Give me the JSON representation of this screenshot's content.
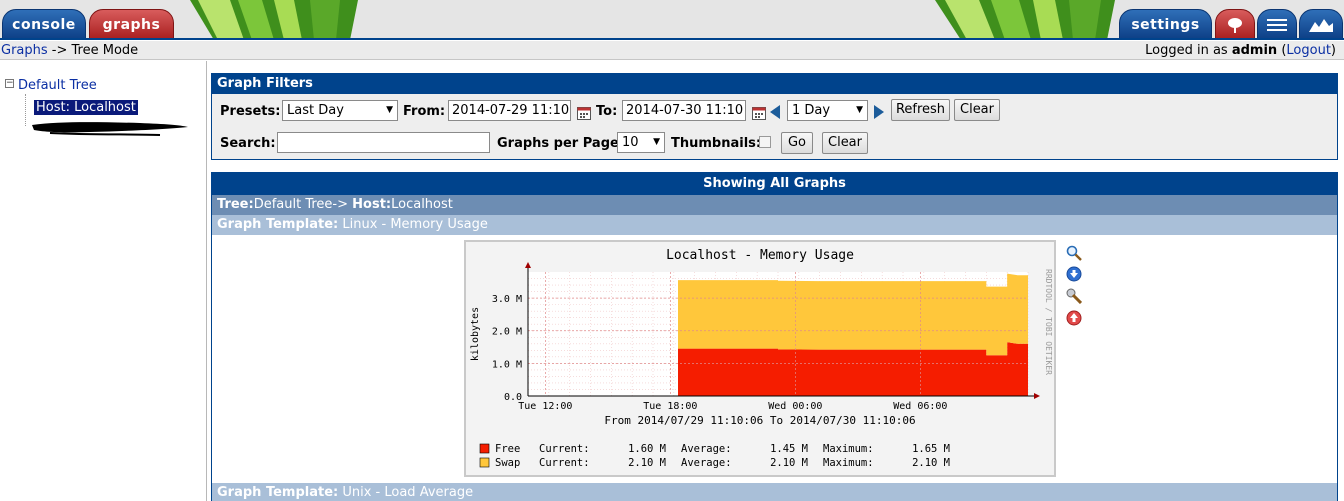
{
  "tabs": {
    "console": "console",
    "graphs": "graphs",
    "settings": "settings"
  },
  "nav": {
    "breadcrumb_link": "Graphs",
    "breadcrumb_rest": "-> Tree Mode",
    "logged_in_prefix": "Logged in as",
    "user": "admin",
    "logout_open": "(",
    "logout": "Logout",
    "logout_close": ")"
  },
  "tree": {
    "toggle": "−",
    "root": "Default Tree",
    "host": "Host: Localhost"
  },
  "filters": {
    "title": "Graph Filters",
    "presets_label": "Presets:",
    "presets_value": "Last Day",
    "from_label": "From:",
    "from_value": "2014-07-29 11:10",
    "to_label": "To:",
    "to_value": "2014-07-30 11:10",
    "timespan_value": "1 Day",
    "refresh": "Refresh",
    "clear": "Clear",
    "search_label": "Search:",
    "search_value": "",
    "per_page_label": "Graphs per Page:",
    "per_page_value": "10",
    "thumbnails_label": "Thumbnails:",
    "go": "Go",
    "clear2": "Clear"
  },
  "graphs_panel": {
    "header": "Showing All Graphs",
    "tree_label": "Tree:",
    "tree_value": "Default Tree->",
    "host_label": "Host:",
    "host_value": "Localhost",
    "template_label": "Graph Template:",
    "template_value": "Linux - Memory Usage",
    "template2_label": "Graph Template:",
    "template2_value": "Unix - Load Average"
  },
  "chart_data": {
    "type": "area",
    "title": "Localhost - Memory Usage",
    "ylabel": "kilobytes",
    "watermark": "RRDTOOL / TOBI OETIKER",
    "yticks": [
      "0.0",
      "1.0 M",
      "2.0 M",
      "3.0 M"
    ],
    "ylim": [
      0,
      3.8
    ],
    "xticks": [
      "Tue 12:00",
      "Tue 18:00",
      "Wed 00:00",
      "Wed 06:00"
    ],
    "xlim_hours": [
      0,
      24
    ],
    "range_text": "From 2014/07/29 11:10:06 To 2014/07/30 11:10:06",
    "x_hours": [
      7.2,
      12.0,
      12.0,
      14.0,
      16.0,
      18.0,
      20.0,
      22.0,
      22.0,
      23.0,
      23.0,
      23.5,
      24.0
    ],
    "series": [
      {
        "name": "Free",
        "color": "#F51D00",
        "values": [
          1.45,
          1.45,
          1.43,
          1.42,
          1.42,
          1.42,
          1.42,
          1.42,
          1.25,
          1.25,
          1.65,
          1.6,
          1.6
        ]
      },
      {
        "name": "Swap",
        "color": "#FFC73B",
        "values": [
          2.1,
          2.1,
          2.1,
          2.1,
          2.1,
          2.1,
          2.1,
          2.1,
          2.1,
          2.1,
          2.1,
          2.1,
          2.1
        ]
      }
    ],
    "legend": [
      {
        "name": "Free",
        "color": "#F51D00",
        "cur_label": "Current:",
        "current": "1.60 M",
        "avg_label": "Average:",
        "average": "1.45 M",
        "max_label": "Maximum:",
        "maximum": "1.65 M"
      },
      {
        "name": "Swap",
        "color": "#FFC73B",
        "cur_label": "Current:",
        "current": "2.10 M",
        "avg_label": "Average:",
        "average": "2.10 M",
        "max_label": "Maximum:",
        "maximum": "2.10 M"
      }
    ]
  }
}
